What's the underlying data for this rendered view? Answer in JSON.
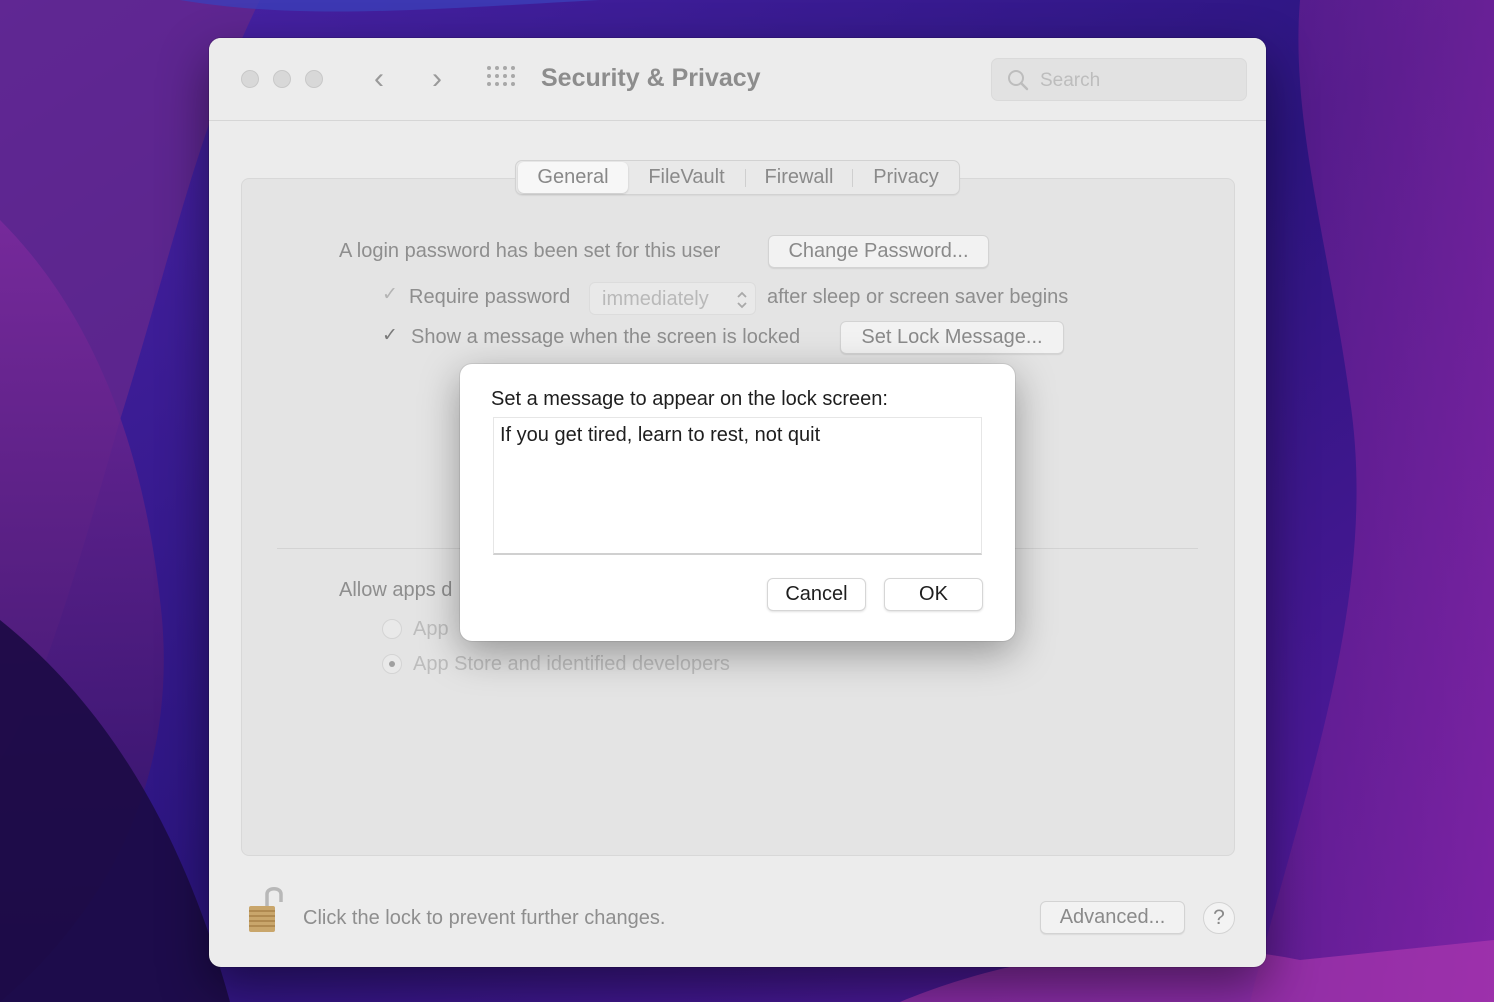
{
  "window": {
    "title": "Security & Privacy",
    "back_glyph": "‹",
    "forward_glyph": "›",
    "search_placeholder": "Search"
  },
  "tabs": [
    {
      "label": "General",
      "selected": true
    },
    {
      "label": "FileVault",
      "selected": false
    },
    {
      "label": "Firewall",
      "selected": false
    },
    {
      "label": "Privacy",
      "selected": false
    }
  ],
  "general": {
    "login_text": "A login password has been set for this user",
    "change_password_label": "Change Password...",
    "require_password_label": "Require password",
    "require_password_checked": true,
    "require_password_delay": "immediately",
    "after_sleep_text": "after sleep or screen saver begins",
    "show_message_label": "Show a message when the screen is locked",
    "show_message_checked": true,
    "set_lock_message_label": "Set Lock Message...",
    "allow_apps_text": "Allow apps d",
    "option_app_store": "App",
    "option_identified": "App Store and identified developers"
  },
  "footer": {
    "lock_text": "Click the lock to prevent further changes.",
    "advanced_label": "Advanced...",
    "help_label": "?"
  },
  "dialog": {
    "prompt": "Set a message to appear on the lock screen:",
    "message_value": "If you get tired, learn to rest, not quit",
    "cancel_label": "Cancel",
    "ok_label": "OK"
  },
  "icons": {
    "check_glyph": "✓",
    "popup_arrows": "⌃⌄"
  }
}
